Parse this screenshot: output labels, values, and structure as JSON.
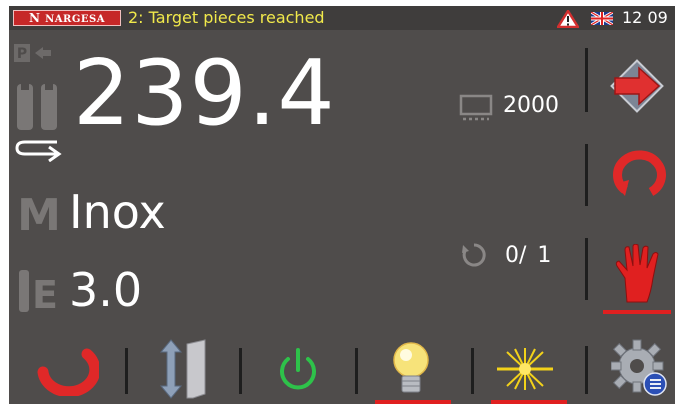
{
  "header": {
    "logo_text": "NARGESA",
    "message": "2: Target pieces reached",
    "time": "12 09"
  },
  "main": {
    "position_value": "239.4",
    "material": "Inox",
    "thickness": "3.0",
    "target_pieces": "2000",
    "counter": "0/ 1"
  },
  "icons": {
    "park": "p-park-icon",
    "clamp": "clamp-icon",
    "return": "return-arrow-icon",
    "material": "material-m-icon",
    "thickness": "thickness-e-icon",
    "pieces": "pieces-icon",
    "counter": "counter-icon"
  },
  "colors": {
    "accent_red": "#e02020",
    "message_yellow": "#f1e94b",
    "power_green": "#2ec24a",
    "screen_bg": "#4f4c4b"
  }
}
